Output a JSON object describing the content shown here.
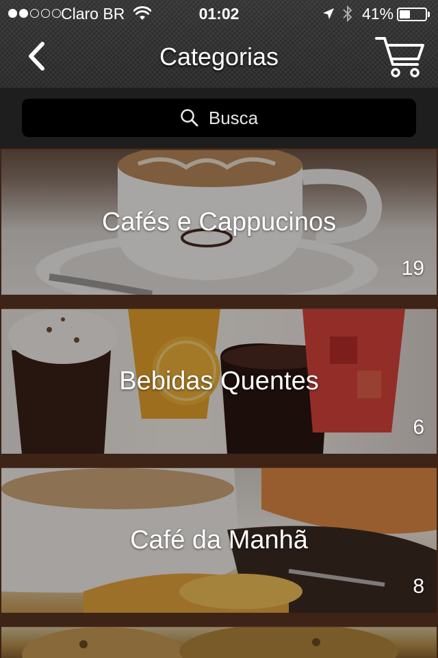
{
  "status_bar": {
    "signal_bars_filled": 2,
    "signal_bars_total": 5,
    "carrier": "Claro BR",
    "time": "01:02",
    "battery_percent": "41%",
    "battery_level": 0.41
  },
  "nav": {
    "title": "Categorias",
    "back_icon": "chevron-left-icon",
    "cart_icon": "shopping-cart-icon"
  },
  "search": {
    "placeholder": "Busca",
    "icon": "search-icon"
  },
  "categories": [
    {
      "name": "Cafés e Cappucinos",
      "count": "19"
    },
    {
      "name": "Bebidas Quentes",
      "count": "6"
    },
    {
      "name": "Café da Manhã",
      "count": "8"
    },
    {
      "name": "",
      "count": ""
    }
  ],
  "colors": {
    "nav_background": "#333333",
    "search_bar_background": "#1e1e1e",
    "search_field_background": "#000000",
    "list_background": "#3d2416"
  }
}
